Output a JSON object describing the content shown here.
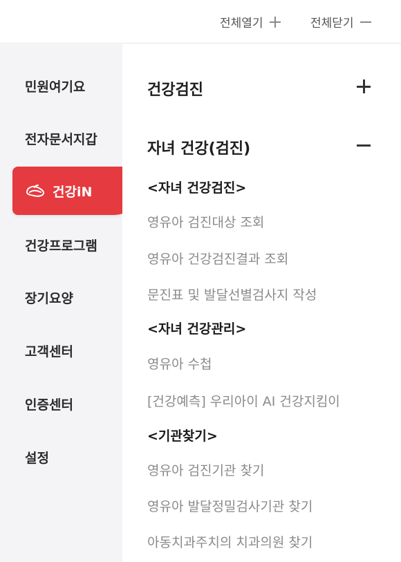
{
  "top": {
    "expand_all": "전체열기",
    "collapse_all": "전체닫기"
  },
  "sidebar": {
    "items": [
      {
        "label": "민원여기요"
      },
      {
        "label": "전자문서지갑"
      },
      {
        "label": "건강iN",
        "active": true
      },
      {
        "label": "건강프로그램"
      },
      {
        "label": "장기요양"
      },
      {
        "label": "고객센터"
      },
      {
        "label": "인증센터"
      },
      {
        "label": "설정"
      }
    ]
  },
  "main": {
    "sections": [
      {
        "title": "건강검진",
        "expanded": false
      },
      {
        "title": "자녀 건강(검진)",
        "expanded": true
      }
    ],
    "groups": [
      {
        "title": "<자녀 건강검진>",
        "links": [
          "영유아 검진대상 조회",
          "영유아 건강검진결과 조회",
          "문진표 및 발달선별검사지 작성"
        ]
      },
      {
        "title": "<자녀 건강관리>",
        "links": [
          "영유아 수첩",
          "[건강예측] 우리아이 AI 건강지킴이"
        ]
      },
      {
        "title": "<기관찾기>",
        "links": [
          "영유아 검진기관 찾기",
          "영유아 발달정밀검사기관 찾기",
          "아동치과주치의 치과의원 찾기"
        ]
      }
    ]
  },
  "colors": {
    "accent": "#e53a3f",
    "sidebar_bg": "#f4f4f6",
    "link_text": "#8a8a8a"
  }
}
